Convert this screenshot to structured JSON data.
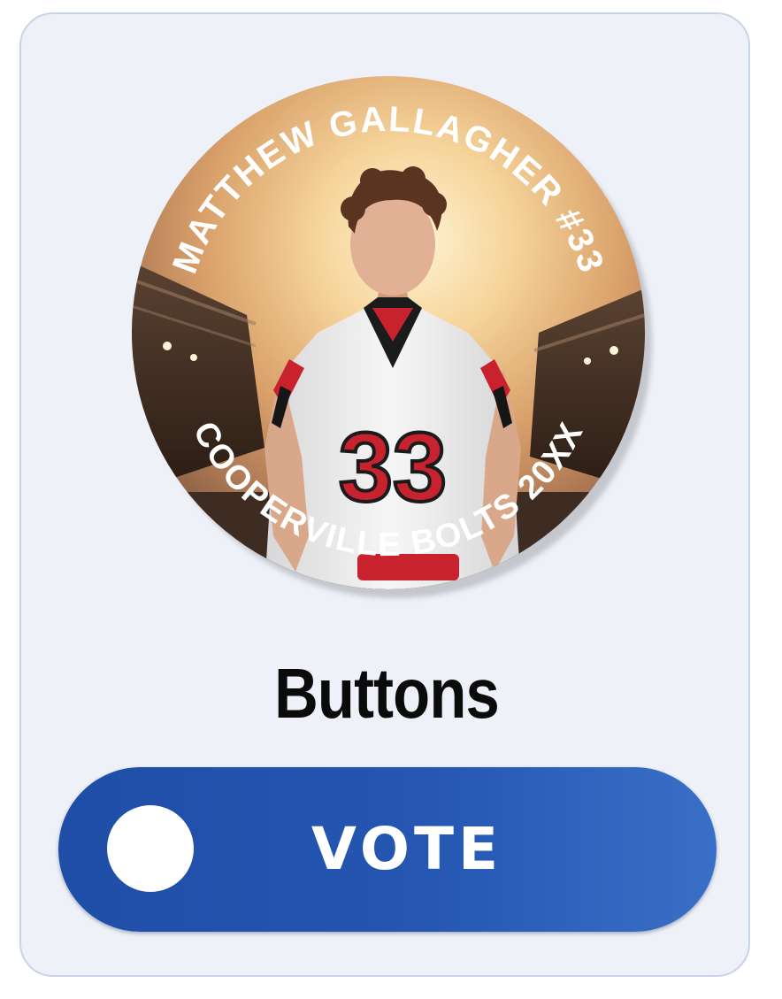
{
  "badge": {
    "top_text": "MATTHEW GALLAGHER #33",
    "bottom_text": "COOPERVILLE BOLTS 20XX",
    "jersey_number": "33",
    "colors": {
      "jersey": "#eeeeee",
      "jersey_trim": "#c8222e",
      "sky_glow": "#f4c98a",
      "stadium_dark": "#3a2a20"
    }
  },
  "product": {
    "title": "Buttons"
  },
  "vote_button": {
    "label": "VOTE",
    "color": "#2456b2"
  }
}
